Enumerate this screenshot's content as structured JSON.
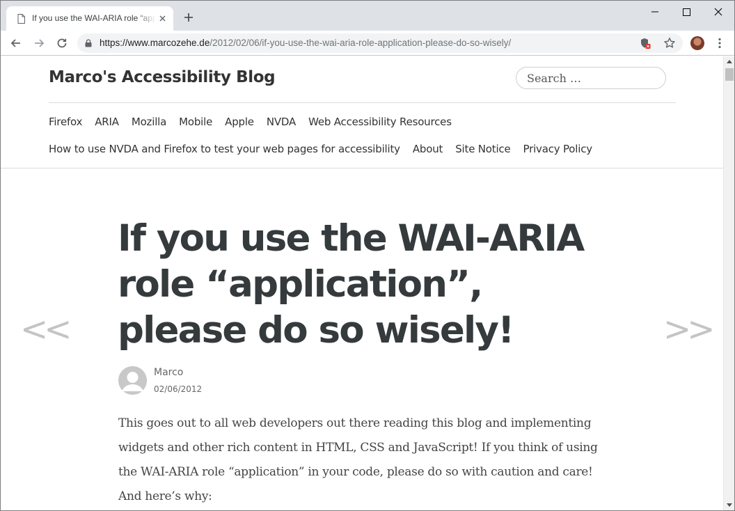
{
  "browser": {
    "tab_title": "If you use the WAI-ARIA role “application”, please do so wisely! – Marco's Accessibility Blog",
    "url_host": "https://www.marcozehe.de",
    "url_path": "/2012/02/06/if-you-use-the-wai-aria-role-application-please-do-so-wisely/"
  },
  "site": {
    "title": "Marco's Accessibility Blog",
    "search_placeholder": "Search …"
  },
  "nav": {
    "row1": [
      "Firefox",
      "ARIA",
      "Mozilla",
      "Mobile",
      "Apple",
      "NVDA",
      "Web Accessibility Resources"
    ],
    "row2": [
      "How to use NVDA and Firefox to test your web pages for accessibility",
      "About",
      "Site Notice",
      "Privacy Policy"
    ]
  },
  "post": {
    "title": "If you use the WAI-ARIA role “application”, please do so wisely!",
    "author": "Marco",
    "date": "02/06/2012",
    "prev_label": "<<",
    "next_label": ">>",
    "body": "This goes out to all web developers out there reading this blog and implementing widgets and other rich content in HTML, CSS and JavaScript! If you think of using the WAI-ARIA role “application” in your code, please do so with caution and care! And here’s why:"
  },
  "colors": {
    "tabstrip": "#dee1e6",
    "omnibox": "#f1f3f4",
    "heading": "#353a3d",
    "arrows": "#c4c4c4"
  }
}
